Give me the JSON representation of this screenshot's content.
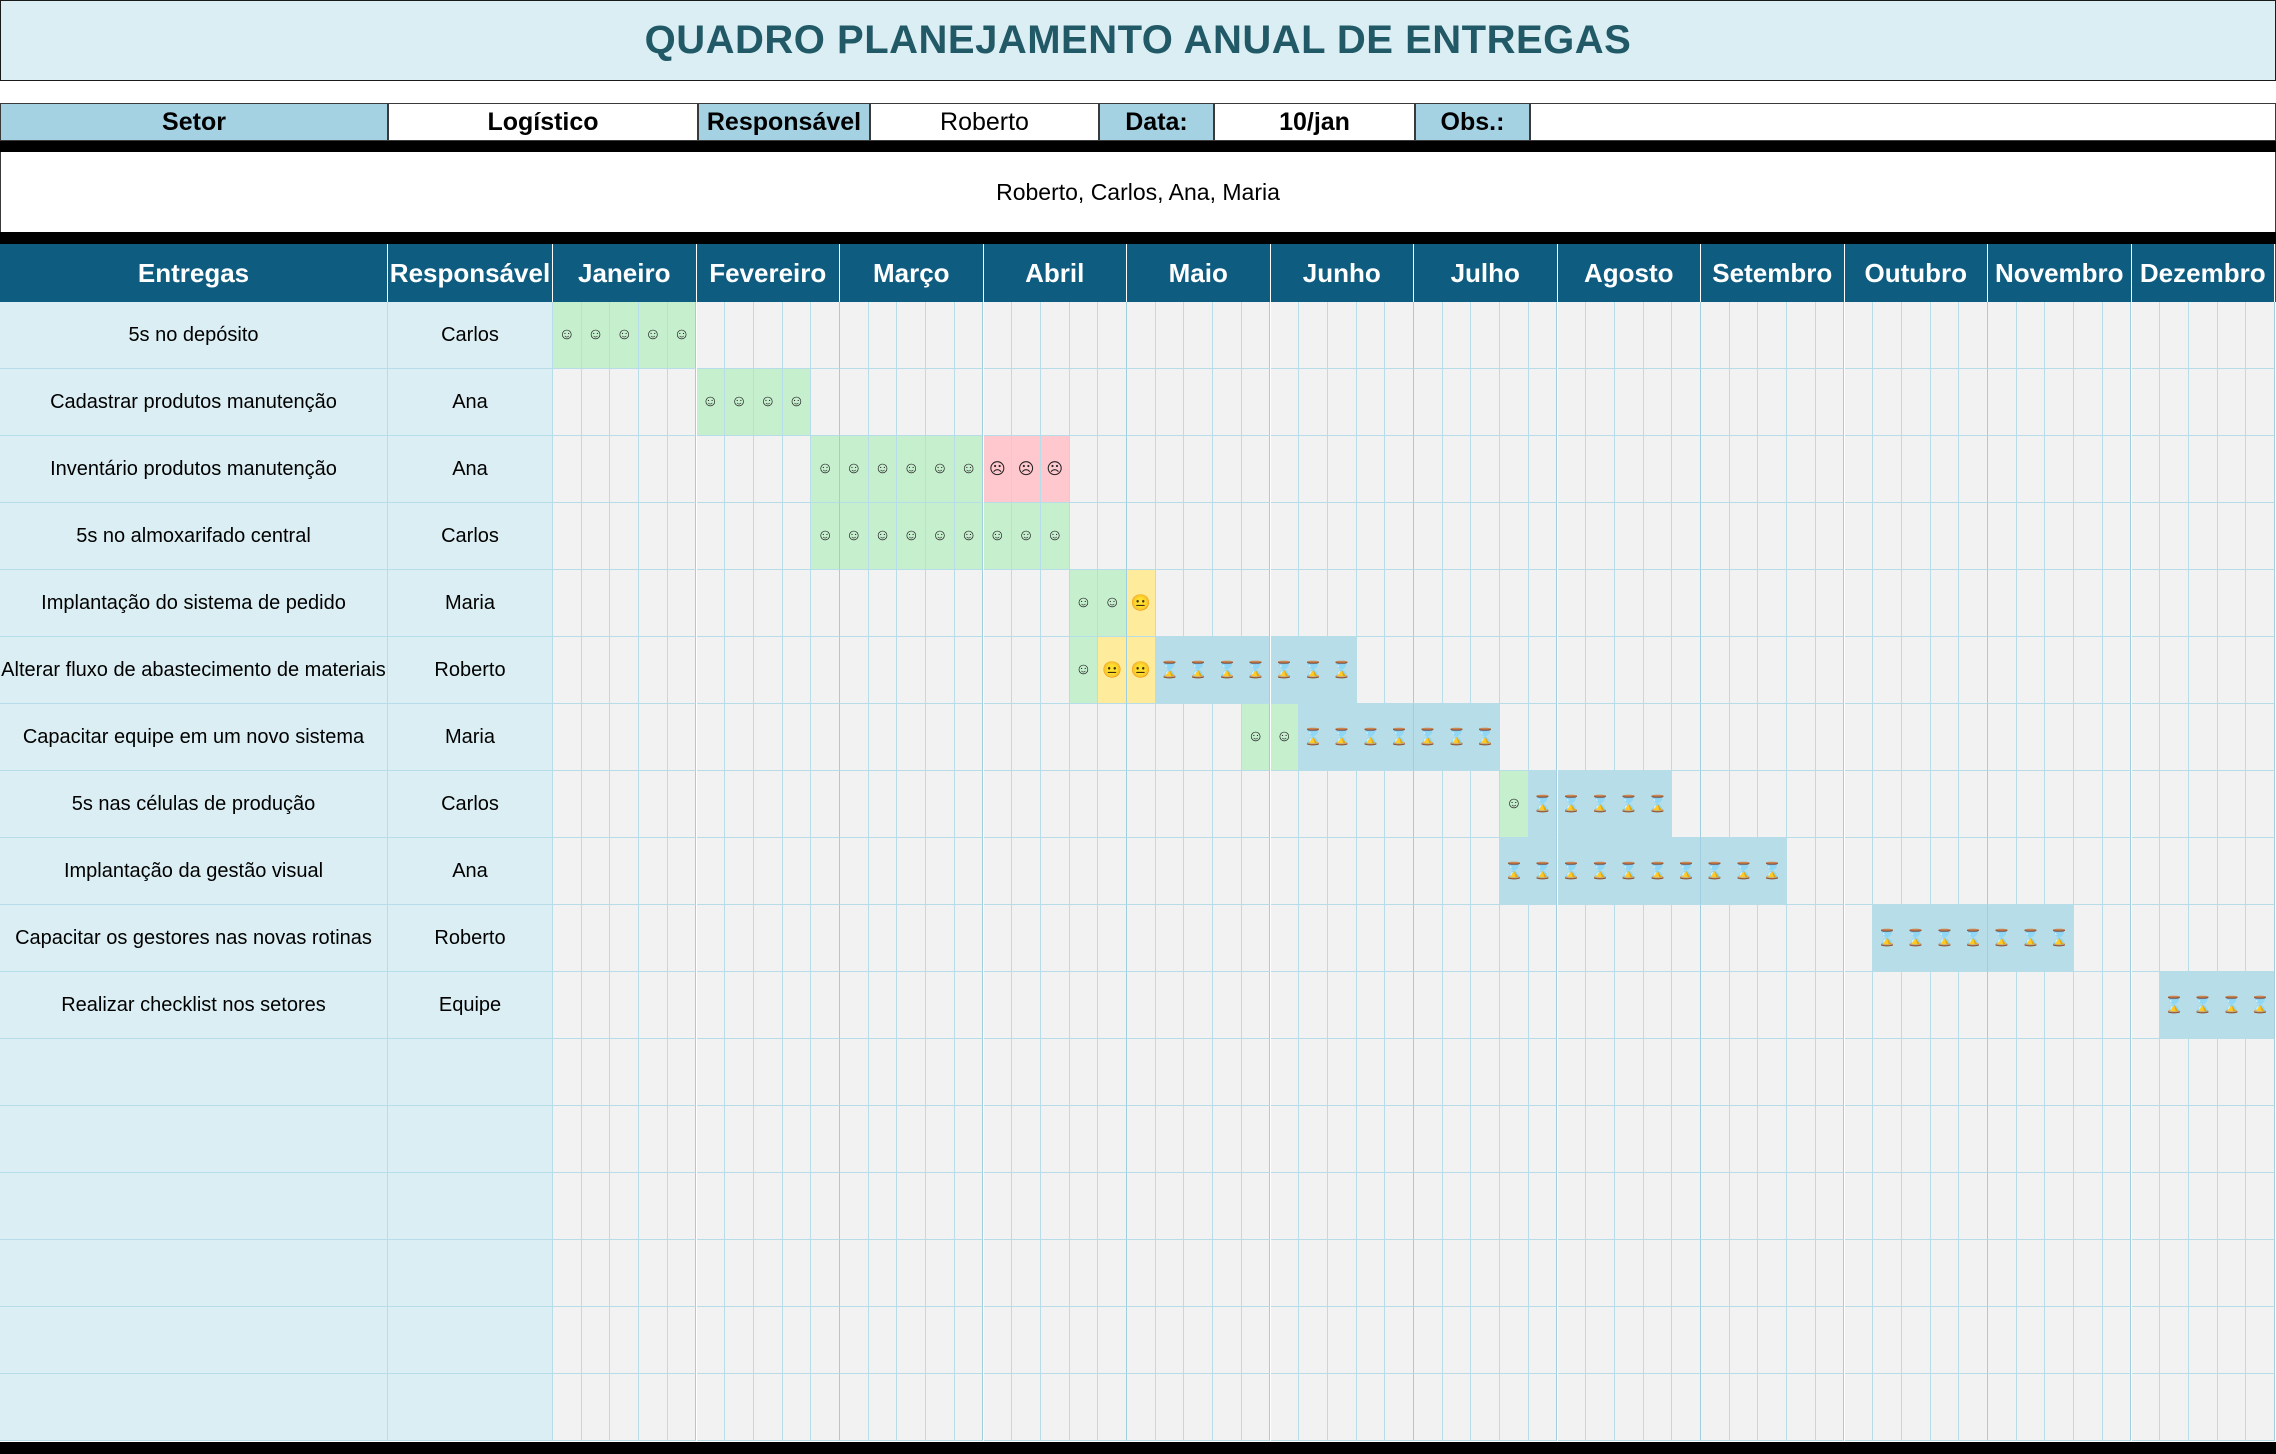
{
  "title": "QUADRO PLANEJAMENTO ANUAL DE ENTREGAS",
  "info": {
    "setor_label": "Setor",
    "setor_value": "Logístico",
    "responsavel_label": "Responsável",
    "responsavel_value": "Roberto",
    "data_label": "Data:",
    "data_value": "10/jan",
    "obs_label": "Obs.:",
    "obs_value": ""
  },
  "team": "Roberto, Carlos, Ana, Maria",
  "headers": {
    "entregas": "Entregas",
    "responsavel": "Responsável",
    "months": [
      "Janeiro",
      "Fevereiro",
      "Março",
      "Abril",
      "Maio",
      "Junho",
      "Julho",
      "Agosto",
      "Setembro",
      "Outubro",
      "Novembro",
      "Dezembro"
    ]
  },
  "legend_symbols": {
    "happy": "☺",
    "neutral": "😐",
    "sad": "☹",
    "pending": "⌛"
  },
  "colors": {
    "happy": "#c6efce",
    "neutral": "#ffeb9c",
    "sad": "#ffc7ce",
    "pending": "#b7dee8",
    "header": "#0e5c80",
    "title": "#215967"
  },
  "rows": [
    {
      "entrega": "5s no depósito",
      "responsavel": "Carlos",
      "cells": [
        [
          1,
          "happy"
        ],
        [
          2,
          "happy"
        ],
        [
          3,
          "happy"
        ],
        [
          4,
          "happy"
        ],
        [
          5,
          "happy"
        ]
      ]
    },
    {
      "entrega": "Cadastrar produtos manutenção",
      "responsavel": "Ana",
      "cells": [
        [
          6,
          "happy"
        ],
        [
          7,
          "happy"
        ],
        [
          8,
          "happy"
        ],
        [
          9,
          "happy"
        ]
      ]
    },
    {
      "entrega": "Inventário produtos manutenção",
      "responsavel": "Ana",
      "cells": [
        [
          10,
          "happy"
        ],
        [
          11,
          "happy"
        ],
        [
          12,
          "happy"
        ],
        [
          13,
          "happy"
        ],
        [
          14,
          "happy"
        ],
        [
          15,
          "happy"
        ],
        [
          16,
          "sad"
        ],
        [
          17,
          "sad"
        ],
        [
          18,
          "sad"
        ]
      ]
    },
    {
      "entrega": "5s no almoxarifado central",
      "responsavel": "Carlos",
      "cells": [
        [
          10,
          "happy"
        ],
        [
          11,
          "happy"
        ],
        [
          12,
          "happy"
        ],
        [
          13,
          "happy"
        ],
        [
          14,
          "happy"
        ],
        [
          15,
          "happy"
        ],
        [
          16,
          "happy"
        ],
        [
          17,
          "happy"
        ],
        [
          18,
          "happy"
        ]
      ]
    },
    {
      "entrega": "Implantação do sistema de pedido",
      "responsavel": "Maria",
      "cells": [
        [
          19,
          "happy"
        ],
        [
          20,
          "happy"
        ],
        [
          21,
          "neutral"
        ]
      ]
    },
    {
      "entrega": "Alterar fluxo de abastecimento de materiais",
      "responsavel": "Roberto",
      "cells": [
        [
          19,
          "happy"
        ],
        [
          20,
          "neutral"
        ],
        [
          21,
          "neutral"
        ],
        [
          22,
          "pending"
        ],
        [
          23,
          "pending"
        ],
        [
          24,
          "pending"
        ],
        [
          25,
          "pending"
        ],
        [
          26,
          "pending"
        ],
        [
          27,
          "pending"
        ],
        [
          28,
          "pending"
        ]
      ]
    },
    {
      "entrega": "Capacitar equipe em um novo sistema",
      "responsavel": "Maria",
      "cells": [
        [
          25,
          "happy"
        ],
        [
          26,
          "happy"
        ],
        [
          27,
          "pending"
        ],
        [
          28,
          "pending"
        ],
        [
          29,
          "pending"
        ],
        [
          30,
          "pending"
        ],
        [
          31,
          "pending"
        ],
        [
          32,
          "pending"
        ],
        [
          33,
          "pending"
        ]
      ]
    },
    {
      "entrega": "5s nas células de produção",
      "responsavel": "Carlos",
      "cells": [
        [
          34,
          "happy"
        ],
        [
          35,
          "pending"
        ],
        [
          36,
          "pending"
        ],
        [
          37,
          "pending"
        ],
        [
          38,
          "pending"
        ],
        [
          39,
          "pending"
        ]
      ]
    },
    {
      "entrega": "Implantação da gestão visual",
      "responsavel": "Ana",
      "cells": [
        [
          34,
          "pending"
        ],
        [
          35,
          "pending"
        ],
        [
          36,
          "pending"
        ],
        [
          37,
          "pending"
        ],
        [
          38,
          "pending"
        ],
        [
          39,
          "pending"
        ],
        [
          40,
          "pending"
        ],
        [
          41,
          "pending"
        ],
        [
          42,
          "pending"
        ],
        [
          43,
          "pending"
        ]
      ]
    },
    {
      "entrega": "Capacitar os gestores nas novas rotinas",
      "responsavel": "Roberto",
      "cells": [
        [
          47,
          "pending"
        ],
        [
          48,
          "pending"
        ],
        [
          49,
          "pending"
        ],
        [
          50,
          "pending"
        ],
        [
          51,
          "pending"
        ],
        [
          52,
          "pending"
        ],
        [
          53,
          "pending"
        ]
      ]
    },
    {
      "entrega": "Realizar checklist nos setores",
      "responsavel": "Equipe",
      "cells": [
        [
          57,
          "pending"
        ],
        [
          58,
          "pending"
        ],
        [
          59,
          "pending"
        ],
        [
          60,
          "pending"
        ]
      ]
    },
    {
      "entrega": "",
      "responsavel": "",
      "cells": []
    },
    {
      "entrega": "",
      "responsavel": "",
      "cells": []
    },
    {
      "entrega": "",
      "responsavel": "",
      "cells": []
    },
    {
      "entrega": "",
      "responsavel": "",
      "cells": []
    },
    {
      "entrega": "",
      "responsavel": "",
      "cells": []
    },
    {
      "entrega": "",
      "responsavel": "",
      "cells": []
    }
  ]
}
